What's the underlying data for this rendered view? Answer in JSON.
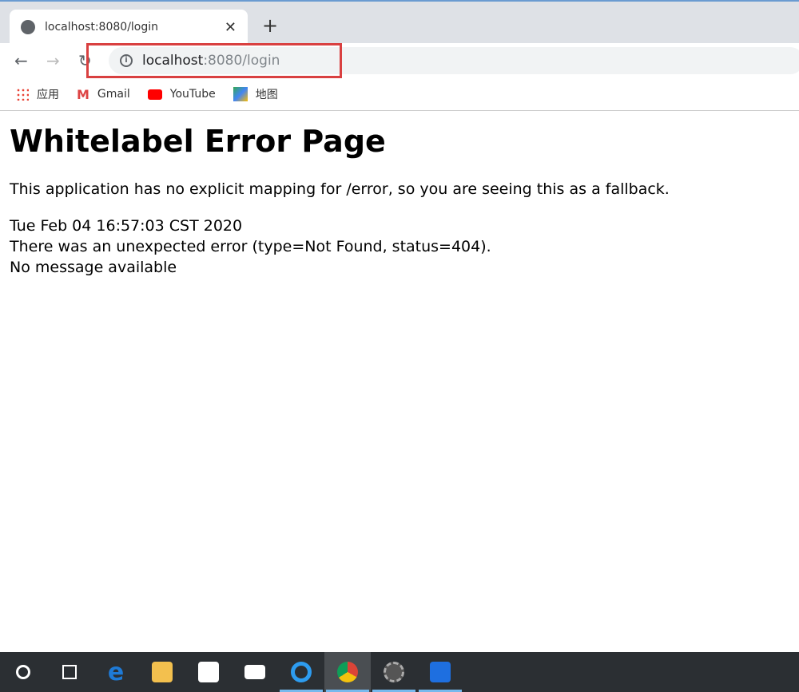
{
  "browser": {
    "tab_title": "localhost:8080/login",
    "url_host": "localhost",
    "url_path": ":8080/login",
    "bookmarks": [
      {
        "label": "应用",
        "icon": "apps-grid-icon"
      },
      {
        "label": "Gmail",
        "icon": "gmail-icon"
      },
      {
        "label": "YouTube",
        "icon": "youtube-icon"
      },
      {
        "label": "地图",
        "icon": "maps-icon"
      }
    ],
    "highlight_color": "#d94040"
  },
  "page": {
    "title": "Whitelabel Error Page",
    "lead": "This application has no explicit mapping for /error, so you are seeing this as a fallback.",
    "timestamp": "Tue Feb 04 16:57:03 CST 2020",
    "error": "There was an unexpected error (type=Not Found, status=404).",
    "message": "No message available"
  },
  "taskbar": {
    "icons": [
      "cortana-icon",
      "task-view-icon",
      "edge-icon",
      "file-explorer-icon",
      "store-icon",
      "mail-icon",
      "qq-browser-icon",
      "chrome-icon",
      "settings-app-icon",
      "security-shield-icon"
    ]
  }
}
